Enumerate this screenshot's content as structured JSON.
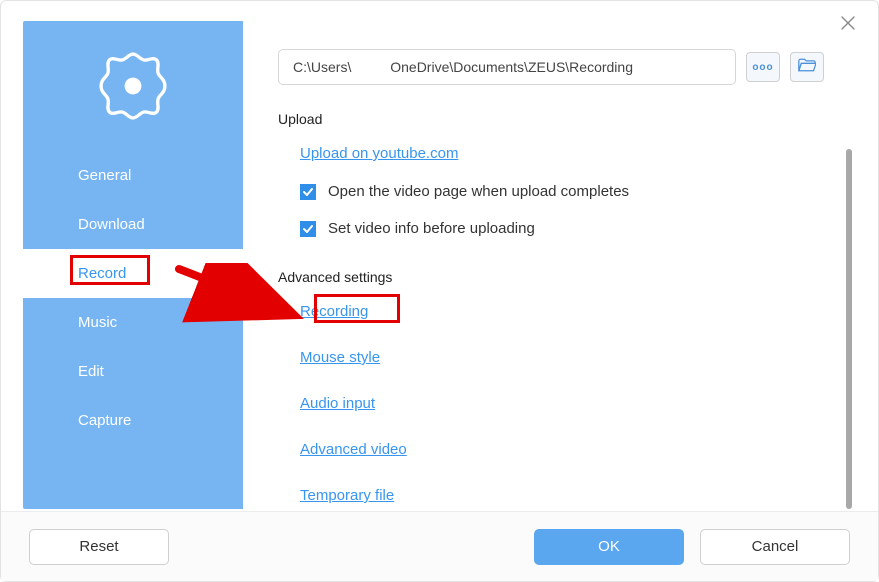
{
  "close_icon_name": "close",
  "path_value": "C:\\Users\\          OneDrive\\Documents\\ZEUS\\Recording",
  "more_label": "ooo",
  "sidebar": {
    "items": [
      {
        "label": "General"
      },
      {
        "label": "Download"
      },
      {
        "label": "Record"
      },
      {
        "label": "Music"
      },
      {
        "label": "Edit"
      },
      {
        "label": "Capture"
      }
    ]
  },
  "sections": {
    "upload_title": "Upload",
    "upload_link": "Upload on youtube.com",
    "check1": "Open the video page when upload completes",
    "check2": "Set video info before uploading",
    "advanced_title": "Advanced settings",
    "adv_links": {
      "recording": "Recording",
      "mouse_style": "Mouse style",
      "audio_input": "Audio input",
      "advanced_video": "Advanced video",
      "temporary_file": "Temporary file"
    }
  },
  "footer": {
    "reset": "Reset",
    "ok": "OK",
    "cancel": "Cancel"
  }
}
